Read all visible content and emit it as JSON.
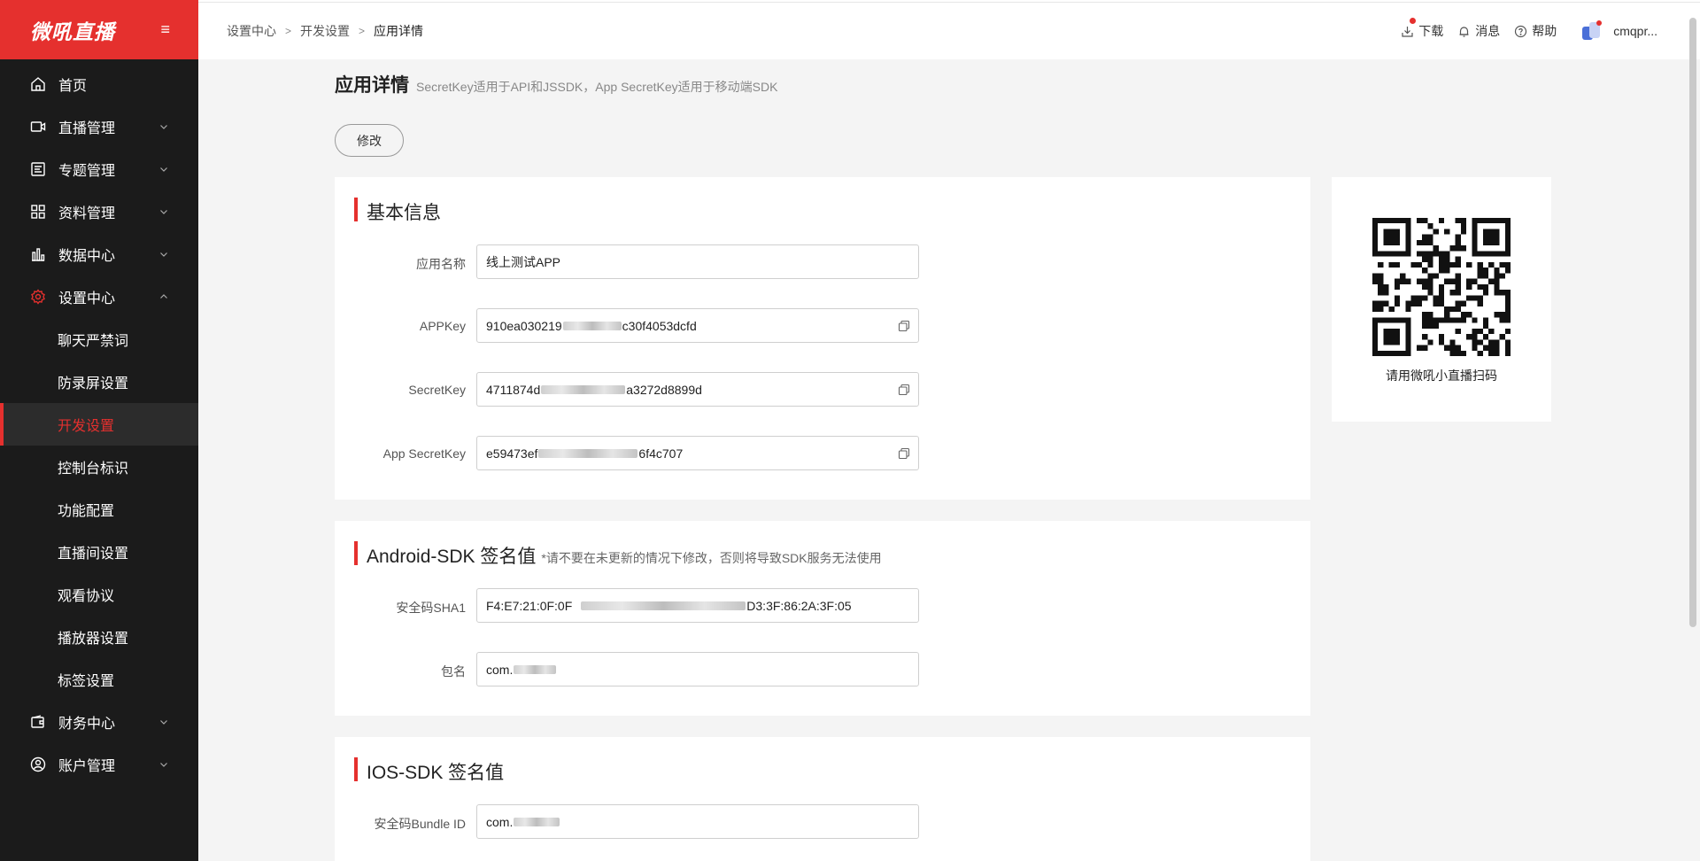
{
  "brand": {
    "logo": "微吼直播",
    "accent": "#e5302e"
  },
  "sidebar": {
    "toggle_icon": "≡",
    "items": [
      {
        "label": "首页",
        "icon": "home-icon"
      },
      {
        "label": "直播管理",
        "icon": "camera-icon"
      },
      {
        "label": "专题管理",
        "icon": "topic-icon"
      },
      {
        "label": "资料管理",
        "icon": "grid-icon"
      },
      {
        "label": "数据中心",
        "icon": "bar-chart-icon"
      },
      {
        "label": "设置中心",
        "icon": "gear-icon"
      }
    ],
    "settings_sub": [
      "聊天严禁词",
      "防录屏设置",
      "开发设置",
      "控制台标识",
      "功能配置",
      "直播间设置",
      "观看协议",
      "播放器设置",
      "标签设置"
    ],
    "active_sub": "开发设置",
    "bottom_items": [
      {
        "label": "财务中心",
        "icon": "wallet-icon"
      },
      {
        "label": "账户管理",
        "icon": "user-icon"
      }
    ]
  },
  "header": {
    "breadcrumb": [
      "设置中心",
      "开发设置",
      "应用详情"
    ],
    "links": {
      "download": "下载",
      "messages": "消息",
      "help": "帮助"
    },
    "username": "cmqpr..."
  },
  "page": {
    "title": "应用详情",
    "subtitle": "SecretKey适用于API和JSSDK，App SecretKey适用于移动端SDK",
    "edit_button": "修改"
  },
  "basic_info": {
    "title": "基本信息",
    "fields": {
      "app_name": {
        "label": "应用名称",
        "value": "线上测试APP"
      },
      "app_key": {
        "label": "APPKey",
        "prefix": "910ea030219",
        "suffix": "c30f4053dcfd"
      },
      "secret_key": {
        "label": "SecretKey",
        "prefix": "4711874d",
        "suffix": "a3272d8899d"
      },
      "app_secret_key": {
        "label": "App SecretKey",
        "prefix": "e59473ef",
        "suffix": "6f4c707"
      }
    }
  },
  "android": {
    "title": "Android-SDK 签名值",
    "note": "*请不要在未更新的情况下修改，否则将导致SDK服务无法使用",
    "sha1": {
      "label": "安全码SHA1",
      "prefix": "F4:E7:21:0F:0F",
      "suffix": "D3:3F:86:2A:3F:05"
    },
    "package": {
      "label": "包名",
      "prefix": "com."
    }
  },
  "ios": {
    "title": "IOS-SDK 签名值",
    "bundle": {
      "label": "安全码Bundle ID",
      "prefix": "com."
    }
  },
  "qr": {
    "caption": "请用微吼小直播扫码"
  }
}
